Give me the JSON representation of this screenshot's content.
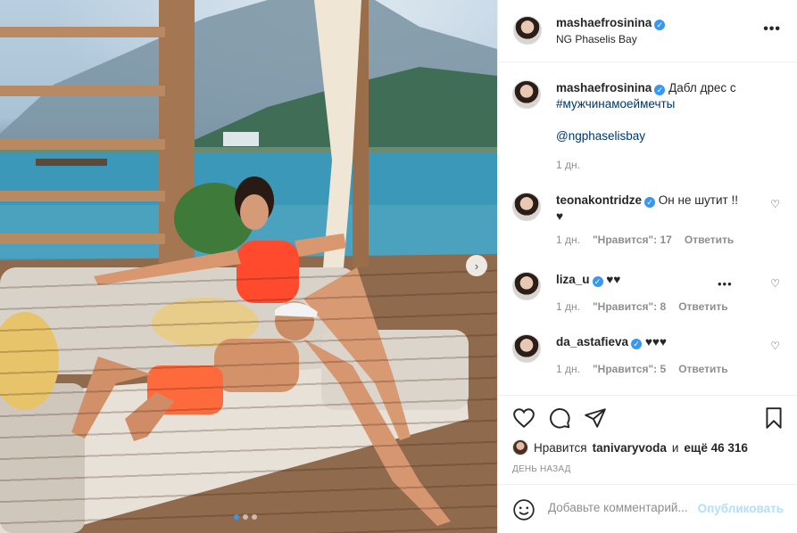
{
  "post": {
    "author": "mashaefrosinina",
    "location": "NG Phaselis Bay",
    "caption_text": "Дабл дрес с",
    "caption_hashtag": "#мужчинамоеймечты",
    "caption_mention": "@ngphaselisbay",
    "caption_time": "1 дн."
  },
  "comments": [
    {
      "user": "teonakontridze",
      "verified": true,
      "text": "Он не шутит !!",
      "text2": "♥",
      "time": "1 дн.",
      "likes": "\"Нравится\": 17",
      "reply": "Ответить"
    },
    {
      "user": "liza_u",
      "verified": true,
      "text": "♥♥",
      "time": "1 дн.",
      "likes": "\"Нравится\": 8",
      "reply": "Ответить"
    },
    {
      "user": "da_astafieva",
      "verified": true,
      "text": "♥♥♥",
      "time": "1 дн.",
      "likes": "\"Нравится\": 5",
      "reply": "Ответить"
    }
  ],
  "likes": {
    "prefix": "Нравится",
    "user": "tanivaryvoda",
    "middle": "и",
    "count": "ещё 46 316"
  },
  "timestamp": "День назад",
  "add_comment": {
    "placeholder": "Добавьте комментарий...",
    "publish_label": "Опубликовать"
  },
  "icons": {
    "verified": "verified-badge-icon",
    "more": "more-options-icon",
    "like": "heart-icon",
    "comment": "comment-icon",
    "share": "send-icon",
    "save": "bookmark-icon",
    "emoji": "emoji-icon"
  },
  "colors": {
    "link": "#00376b",
    "verified": "#3897f0",
    "muted": "#8e8e8e",
    "publish_disabled": "#b2dffc"
  },
  "carousel": {
    "slides": 3,
    "current": 1
  }
}
